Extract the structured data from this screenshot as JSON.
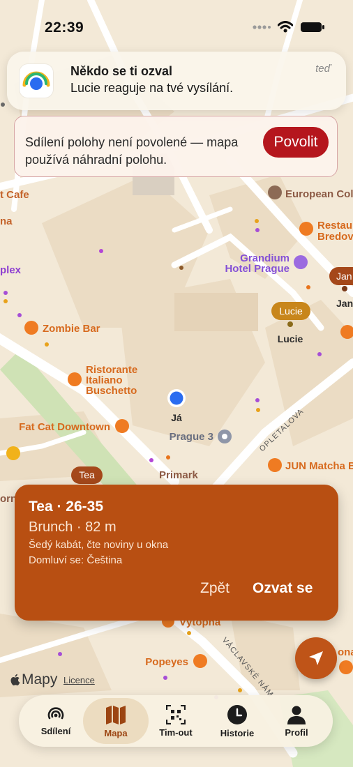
{
  "status_bar": {
    "time": "22:39"
  },
  "notification": {
    "title": "Někdo se ti ozval",
    "body": "Lucie reaguje na tvé vysílání.",
    "time": "teď"
  },
  "location_banner": {
    "text": "Sdílení polohy není povolené — mapa používá náhradní polohu.",
    "button": "Povolit"
  },
  "map": {
    "pois": {
      "cafe": "t Cafe",
      "na": "na",
      "plex": "plex",
      "european": "European Coll",
      "restaurant_1": "Restau",
      "restaurant_2": "Bredov",
      "grandium_1": "Grandium",
      "grandium_2": "Hotel Prague",
      "zombie_bar": "Zombie Bar",
      "ristorante_1": "Ristorante",
      "ristorante_2": "Italiano",
      "ristorante_3": "Buschetto",
      "fat_cat": "Fat Cat Downtown",
      "prague3": "Prague 3",
      "primark": "Primark",
      "jun_matcha": "JUN Matcha B",
      "vytopna": "Výtopna",
      "popeyes": "Popeyes",
      "orna": "orna",
      "ona": "ona"
    },
    "streets": {
      "opletalova": "OPLETALOVA",
      "vaclavske": "VÁCLAVSKÉ NÁM"
    },
    "people": {
      "lucie_bubble": "Lucie",
      "lucie_name": "Lucie",
      "jan_bubble": "Jan",
      "jan_name": "Jan",
      "tea_bubble": "Tea",
      "me": "Já"
    }
  },
  "person_card": {
    "title": "Tea · 26-35",
    "subtitle": "Brunch · 82 m",
    "description": "Šedý kabát, čte noviny u okna",
    "languages": "Domluví se: Čeština",
    "back": "Zpět",
    "respond": "Ozvat se"
  },
  "attribution": {
    "maps": "Mapy",
    "licence": "Licence"
  },
  "tabs": [
    {
      "label": "Sdílení",
      "icon": "broadcast-icon"
    },
    {
      "label": "Mapa",
      "icon": "map-icon"
    },
    {
      "label": "Tim-out",
      "icon": "qr-code-icon"
    },
    {
      "label": "Historie",
      "icon": "clock-icon"
    },
    {
      "label": "Profil",
      "icon": "person-icon"
    }
  ],
  "colors": {
    "accent": "#b84f12",
    "alert": "#b5161d",
    "map_bg": "#f3e9d7"
  }
}
